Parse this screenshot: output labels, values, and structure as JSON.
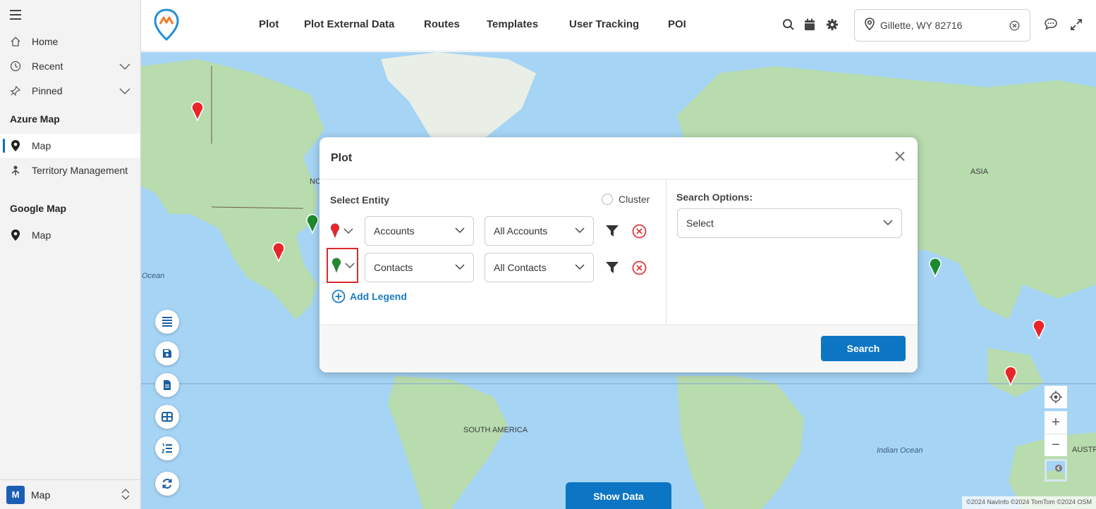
{
  "sidebar": {
    "items": [
      {
        "label": "Home"
      },
      {
        "label": "Recent"
      },
      {
        "label": "Pinned"
      }
    ],
    "sections": [
      {
        "title": "Azure Map",
        "items": [
          {
            "label": "Map"
          },
          {
            "label": "Territory Management"
          }
        ]
      },
      {
        "title": "Google Map",
        "items": [
          {
            "label": "Map"
          }
        ]
      }
    ],
    "footer": {
      "badge": "M",
      "label": "Map"
    }
  },
  "topbar": {
    "nav": [
      "Plot",
      "Plot External Data",
      "Routes",
      "Templates",
      "User Tracking",
      "POI"
    ],
    "location": {
      "value": "Gillette, WY 82716"
    },
    "icons": [
      "search-icon",
      "calendar-icon",
      "gear-icon",
      "chat-icon",
      "expand-icon"
    ]
  },
  "map": {
    "labels": {
      "asia": "ASIA",
      "north_america_partial": "NO",
      "south_america": "SOUTH AMERICA",
      "ocean_left": "Ocean",
      "indian_ocean": "Indian Ocean",
      "australia_partial": "AUSTR"
    },
    "attribution": "©2024 NavInfo ©2024 TomTom ©2024 OSM",
    "show_data": "Show Data",
    "zoom_in": "+",
    "zoom_out": "−"
  },
  "dialog": {
    "title": "Plot",
    "select_entity": "Select Entity",
    "cluster": "Cluster",
    "rows": [
      {
        "entity": "Accounts",
        "view": "All Accounts",
        "pin_color": "#e8262a"
      },
      {
        "entity": "Contacts",
        "view": "All Contacts",
        "pin_color": "#1e8a2e"
      }
    ],
    "add_legend": "Add Legend",
    "search_options_label": "Search Options:",
    "search_options_value": "Select",
    "search_button": "Search"
  },
  "colors": {
    "accent": "#0d76c4",
    "pin_red": "#e8262a",
    "pin_green": "#1e8a2e",
    "highlight": "#d92b2b"
  }
}
